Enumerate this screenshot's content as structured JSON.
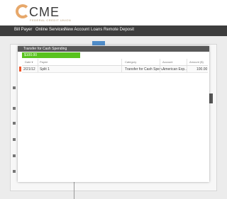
{
  "brand": {
    "logo_text": "CME",
    "logo_sub": "FEDERAL CREDIT UNION"
  },
  "nav": {
    "items": [
      "Bill Payer",
      "Online Services",
      "New Account",
      "Loans",
      "Remote Deposit"
    ]
  },
  "modal": {
    "title": "Transfer for Cash Spending",
    "amount": "$100.00",
    "columns": [
      "Date ▾",
      "Payee",
      "Category",
      "Account",
      "Amount ($)"
    ],
    "rows": [
      {
        "date": "2/21/12",
        "payee": "Split 1",
        "category": "Transfer for Cash Spen...",
        "account": "American Exp...",
        "amount": "100.00"
      }
    ]
  },
  "colors": {
    "accent_green": "#58c21e",
    "nav_bg": "#3d3d3d",
    "logo_orange": "#e7a86b",
    "row_flag": "#f0562a"
  }
}
